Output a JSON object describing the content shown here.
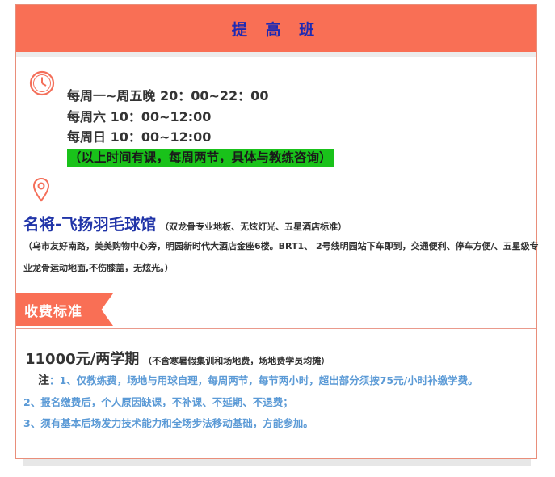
{
  "header": {
    "title": "提 高 班"
  },
  "schedule": {
    "line1": "每周一~周五晚  20：00~22：00",
    "line2": "每周六  10：00~12:00",
    "line3": "每周日  10：00~12:00",
    "note": "（以上时间有课，每周两节，具体与教练咨询）"
  },
  "venue": {
    "name": "名将-飞扬羽毛球馆",
    "desc": "（双龙骨专业地板、无炫灯光、五星酒店标准）",
    "address": "（乌市友好南路，美美购物中心旁，明园新时代大酒店金座6楼。BRT1、 2号线明园站下车即到，交通便利、停车方便/、五星级专业龙骨运动地面,不伤膝盖，无炫光。）"
  },
  "fee": {
    "section_title": "收费标准",
    "price": "11000元/两学期",
    "price_note": "（不含寒暑假集训和场地费，场地费学员均摊）",
    "notes_label": "注",
    "note1": "：1、仅教练费，场地与用球自理，每周两节，每节两小时，超出部分须按75元/小时补缴学费。",
    "note2": "2、报名缴费后，个人原因缺课，不补课、不延期、不退费；",
    "note3": "3、须有基本后场发力技术能力和全场步法移动基础，方能参加。"
  },
  "colors": {
    "accent": "#f96f55",
    "title_blue": "#1f2ab3",
    "highlight_green": "#19c21a",
    "notes_blue": "#5b9ad6"
  },
  "icons": {
    "time": "clock-icon",
    "location": "pin-icon"
  }
}
